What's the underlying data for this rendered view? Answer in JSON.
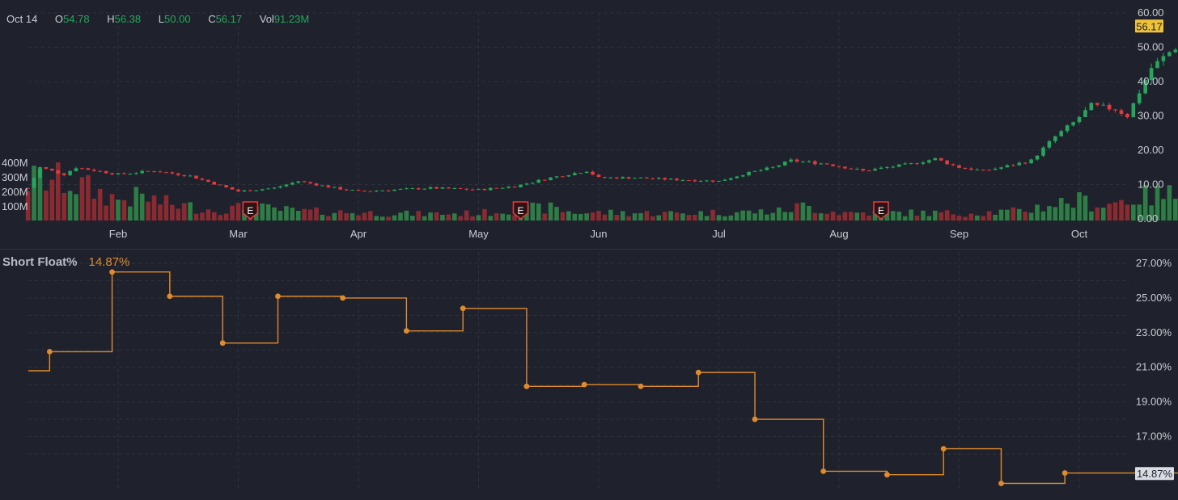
{
  "ohlc_header": {
    "date": "Oct 14",
    "open_label": "O",
    "open": "54.78",
    "high_label": "H",
    "high": "56.38",
    "low_label": "L",
    "low": "50.00",
    "close_label": "C",
    "close": "56.17",
    "volume_label": "Vol",
    "volume": "91.23M"
  },
  "colors": {
    "background": "#1f222c",
    "up": "#26a65b",
    "down": "#e5393f",
    "volume_up": "#2e7d45",
    "volume_down": "#8b2a30",
    "short_float_line": "#e08a2e",
    "last_price_badge": "#f0c23a",
    "earnings_marker": "#e5393f",
    "grid": "#2e323d",
    "axis_text": "#c9ccd4"
  },
  "chart_data": [
    {
      "type": "candlestick",
      "x_ticks": [
        "Feb",
        "Mar",
        "Apr",
        "May",
        "Jun",
        "Jul",
        "Aug",
        "Sep",
        "Oct"
      ],
      "y_ticks": [
        "60.00",
        "50.00",
        "40.00",
        "30.00",
        "20.00",
        "10.00",
        "0.00"
      ],
      "ylim": [
        0,
        60
      ],
      "last_price_label": "56.17",
      "volume_ticks": [
        "400M",
        "300M",
        "200M",
        "100M"
      ],
      "volume_ylim": [
        0,
        400
      ],
      "earnings_markers": [
        {
          "label": "E",
          "month_index": 1.1
        },
        {
          "label": "E",
          "month_index": 3.35
        },
        {
          "label": "E",
          "month_index": 6.35
        }
      ],
      "price_path": [
        [
          -0.75,
          9
        ],
        [
          -0.65,
          15
        ],
        [
          -0.45,
          13
        ],
        [
          -0.35,
          15
        ],
        [
          0,
          13
        ],
        [
          0.3,
          14
        ],
        [
          0.6,
          12.5
        ],
        [
          1.0,
          8
        ],
        [
          1.3,
          9
        ],
        [
          1.5,
          11
        ],
        [
          1.8,
          9
        ],
        [
          2.0,
          8
        ],
        [
          2.3,
          8.5
        ],
        [
          2.6,
          9
        ],
        [
          3.0,
          8.5
        ],
        [
          3.3,
          9.5
        ],
        [
          3.6,
          12
        ],
        [
          3.9,
          14
        ],
        [
          4.0,
          12
        ],
        [
          4.3,
          12
        ],
        [
          4.6,
          11.5
        ],
        [
          5.0,
          11
        ],
        [
          5.2,
          13
        ],
        [
          5.45,
          15
        ],
        [
          5.6,
          17
        ],
        [
          5.9,
          16
        ],
        [
          6.2,
          14
        ],
        [
          6.4,
          15
        ],
        [
          6.6,
          16
        ],
        [
          6.8,
          17.5
        ],
        [
          7.0,
          15
        ],
        [
          7.2,
          14
        ],
        [
          7.35,
          15
        ],
        [
          7.6,
          17
        ],
        [
          7.8,
          24
        ],
        [
          7.95,
          28
        ],
        [
          8.1,
          33
        ],
        [
          8.3,
          32
        ],
        [
          8.4,
          30
        ],
        [
          8.6,
          44
        ],
        [
          8.8,
          50
        ],
        [
          8.95,
          53
        ],
        [
          9.0,
          56
        ]
      ],
      "volume_profile": [
        [
          -0.75,
          300
        ],
        [
          -0.5,
          320
        ],
        [
          -0.3,
          260
        ],
        [
          0,
          160
        ],
        [
          0.2,
          180
        ],
        [
          0.4,
          130
        ],
        [
          0.8,
          80
        ],
        [
          1.1,
          100
        ],
        [
          1.5,
          70
        ],
        [
          2.0,
          60
        ],
        [
          2.5,
          50
        ],
        [
          3.0,
          55
        ],
        [
          3.4,
          90
        ],
        [
          3.6,
          95
        ],
        [
          3.8,
          60
        ],
        [
          4.1,
          60
        ],
        [
          4.5,
          55
        ],
        [
          5.0,
          60
        ],
        [
          5.5,
          70
        ],
        [
          5.7,
          110
        ],
        [
          6.0,
          60
        ],
        [
          6.5,
          60
        ],
        [
          7.0,
          55
        ],
        [
          7.5,
          70
        ],
        [
          7.8,
          130
        ],
        [
          8.0,
          150
        ],
        [
          8.2,
          120
        ],
        [
          8.5,
          180
        ],
        [
          8.8,
          200
        ],
        [
          9.0,
          150
        ]
      ]
    },
    {
      "type": "line",
      "step": true,
      "name": "Short Float%",
      "last_value_label": "14.87%",
      "y_ticks": [
        "27.00%",
        "25.00%",
        "23.00%",
        "21.00%",
        "19.00%",
        "17.00%"
      ],
      "ylim": [
        14,
        27.6
      ],
      "start_value": 20.8,
      "end_month_index": 9.45,
      "points": [
        {
          "m": -0.57,
          "v": 21.9
        },
        {
          "m": -0.05,
          "v": 26.5
        },
        {
          "m": 0.43,
          "v": 25.1
        },
        {
          "m": 0.87,
          "v": 22.4
        },
        {
          "m": 1.33,
          "v": 25.1
        },
        {
          "m": 1.87,
          "v": 25.0
        },
        {
          "m": 2.4,
          "v": 23.1
        },
        {
          "m": 2.87,
          "v": 24.4
        },
        {
          "m": 3.4,
          "v": 19.9
        },
        {
          "m": 3.88,
          "v": 20.0
        },
        {
          "m": 4.35,
          "v": 19.9
        },
        {
          "m": 4.83,
          "v": 20.7
        },
        {
          "m": 5.3,
          "v": 18.0
        },
        {
          "m": 5.87,
          "v": 15.0
        },
        {
          "m": 6.4,
          "v": 14.8
        },
        {
          "m": 6.87,
          "v": 16.3
        },
        {
          "m": 7.35,
          "v": 14.3
        },
        {
          "m": 7.88,
          "v": 14.9
        }
      ]
    }
  ]
}
